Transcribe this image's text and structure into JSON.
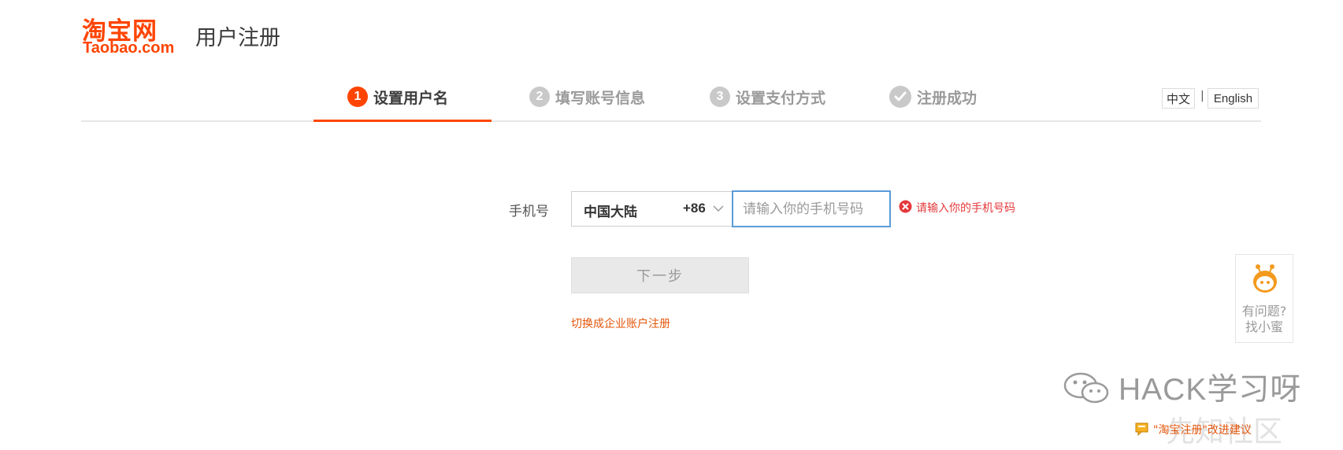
{
  "header": {
    "logo_cn": "淘宝网",
    "logo_en": "Taobao.com",
    "title": "用户注册"
  },
  "steps": [
    {
      "num": "1",
      "label": "设置用户名",
      "state": "active"
    },
    {
      "num": "2",
      "label": "填写账号信息",
      "state": "pending"
    },
    {
      "num": "3",
      "label": "设置支付方式",
      "state": "pending"
    },
    {
      "num": "",
      "label": "注册成功",
      "state": "pending"
    }
  ],
  "lang": {
    "cn": "中文",
    "separator": "|",
    "en": "English"
  },
  "form": {
    "phone_label": "手机号",
    "region_name": "中国大陆",
    "region_code": "+86",
    "phone_value": "",
    "phone_placeholder": "请输入你的手机号码",
    "error_text": "请输入你的手机号码",
    "next_label": "下一步",
    "switch_link": "切换成企业账户注册"
  },
  "help": {
    "line1": "有问题?",
    "line2": "找小蜜"
  },
  "watermark": {
    "wechat_text": "HACK学习呀",
    "xz_text": "先知社区"
  },
  "feedback": {
    "text": "\"淘宝注册\"改进建议"
  },
  "colors": {
    "brand": "#ff4400",
    "error": "#e4393c",
    "link": "#e4570c",
    "focus": "#5b9bd8"
  }
}
